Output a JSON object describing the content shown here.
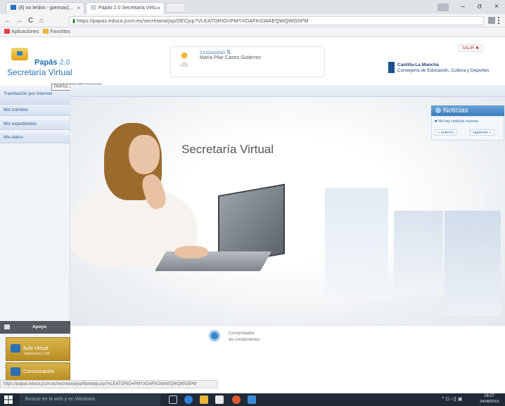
{
  "browser": {
    "tabs": [
      {
        "label": "(8) no leídos - jpennas(...",
        "icon": "mail-icon"
      },
      {
        "label": "Papás 2.0 Secretaría Virtu...",
        "icon": "page-icon"
      }
    ],
    "close_glyph": "×",
    "window_controls": {
      "minimize": "–",
      "maximize": "σ",
      "close": "×"
    },
    "nav": {
      "back": "←",
      "forward": "→",
      "reload": "C",
      "home": "⌂"
    },
    "url": "https://papas.educa.jccm.es/secretaria/jsp/OECjsp?VLEATORIO=PMYXDAFKGWAEQWQWG5PM",
    "url_secure_prefix": "https",
    "bookmarks": [
      {
        "label": "Aplicaciones"
      },
      {
        "label": "Favoritos"
      }
    ]
  },
  "header": {
    "logo_title": "Papás",
    "logo_version": "2.0",
    "logo_subtitle": "Secretaría Virtual",
    "user_role": "CIUDADANO",
    "user_name": "María Pilar Castro Gutiérrez",
    "institution_line1": "Castilla-La Mancha",
    "institution_line2": "Consejería de Educación, Cultura y Deportes",
    "logout_label": "SALIR"
  },
  "tooltip": "PAPÁS 2.0 - Secretaría",
  "sidebar": {
    "items": [
      {
        "label": "Tramitación por Internet"
      },
      {
        "label": "Mis trámites"
      },
      {
        "label": "Mis expedientes"
      },
      {
        "label": "Mis datos"
      }
    ],
    "apoyo_label": "Apoyo",
    "banners": [
      {
        "label": "Aula Virtual",
        "sub": "Educamos CLM"
      },
      {
        "label": "Comunicación",
        "sub": ""
      }
    ]
  },
  "hero": {
    "title": "Secretaría Virtual"
  },
  "noticias": {
    "title": "Noticias",
    "item": "No hay noticias nuevas",
    "prev": "« anterior",
    "next": "siguiente »"
  },
  "footer": {
    "comp_line1": "Comprobador",
    "comp_line2": "de componentes"
  },
  "statusbar": "https://papas.educa.jccm.es/secretaria/jsp/Bandeja.jsp?ALEATORIO=PMYXDAFKGWAEQWQWG5PM",
  "taskbar": {
    "search": "Buscar en la web y en Windows",
    "time": "18:27",
    "date": "24/08/2015",
    "tray": "^ ⊡ ◁) ▣"
  },
  "colors": {
    "brand_blue": "#2a72b5",
    "noticias_blue": "#3b7bbd",
    "sidebar_blue": "#2d5e98",
    "banner_gold": "#c99d2c",
    "taskbar": "#1f2a36"
  }
}
